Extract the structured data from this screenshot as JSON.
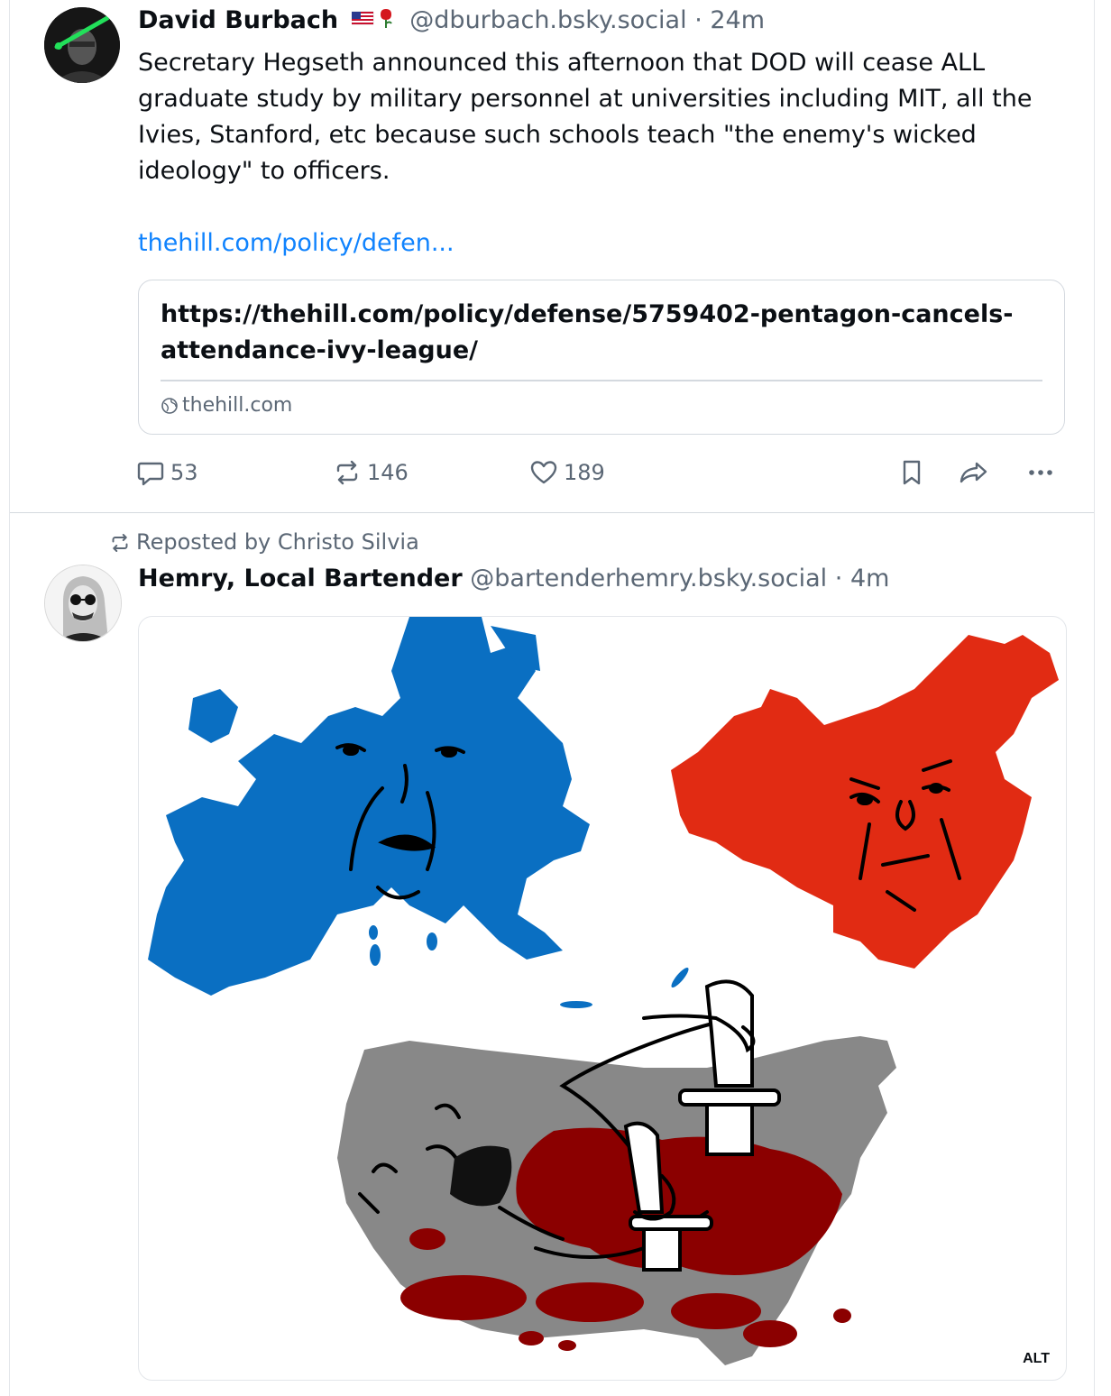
{
  "post1": {
    "author_name": "David Burbach",
    "handle": "@dburbach.bsky.social",
    "separator": "·",
    "time": "24m",
    "text": "Secretary Hegseth announced this afternoon that DOD will cease ALL graduate study by military personnel at universities including MIT, all the Ivies, Stanford, etc because such schools teach \"the enemy's wicked ideology\" to officers.",
    "link_text": "thehill.com/policy/defen...",
    "card": {
      "title": "https://thehill.com/policy/defense/5759402-pentagon-cancels-attendance-ivy-league/",
      "domain": "thehill.com"
    },
    "actions": {
      "replies": "53",
      "reposts": "146",
      "likes": "189"
    },
    "icons": [
      "reply-icon",
      "repost-icon",
      "like-icon",
      "bookmark-icon",
      "share-icon",
      "more-icon"
    ]
  },
  "post2": {
    "repost_label": "Reposted by Christo Silvia",
    "author_name": "Hemry, Local Bartender",
    "handle": "@bartenderhemry.bsky.social",
    "separator": "·",
    "time": "4m",
    "alt_label": "ALT"
  },
  "colors": {
    "link": "#1083fe",
    "muted": "#5b6775",
    "europe": "#0a6fc2",
    "china": "#e12b13",
    "usa": "#888888",
    "blood": "#8b0000"
  }
}
